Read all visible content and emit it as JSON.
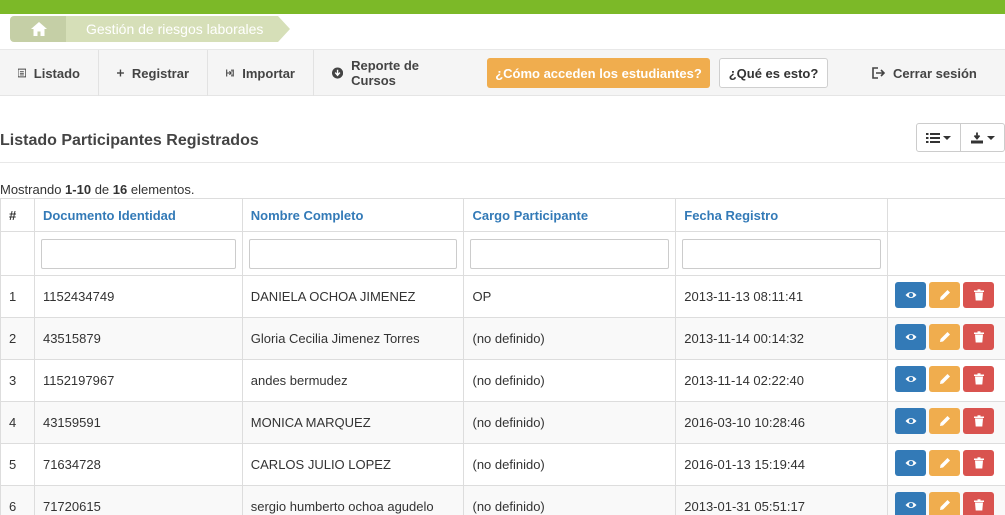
{
  "breadcrumb": {
    "home_icon": "home-icon",
    "current": "Gestión de riesgos laborales"
  },
  "toolbar": {
    "list_label": "Listado",
    "register_label": "Registrar",
    "import_label": "Importar",
    "report_label": "Reporte de Cursos",
    "how_label": "¿Cómo acceden los estudiantes?",
    "what_label": "¿Qué es esto?",
    "logout_label": "Cerrar sesión"
  },
  "page": {
    "title": "Listado Participantes Registrados",
    "summary_prefix": "Mostrando ",
    "summary_range": "1-10",
    "summary_mid": " de ",
    "summary_total": "16",
    "summary_suffix": " elementos."
  },
  "table": {
    "columns": [
      "#",
      "Documento Identidad",
      "Nombre Completo",
      "Cargo Participante",
      "Fecha Registro"
    ],
    "rows": [
      {
        "num": "1",
        "doc": "1152434749",
        "name": "DANIELA OCHOA JIMENEZ",
        "cargo": "OP",
        "fecha": "2013-11-13 08:11:41"
      },
      {
        "num": "2",
        "doc": "43515879",
        "name": "Gloria Cecilia Jimenez Torres",
        "cargo": "(no definido)",
        "fecha": "2013-11-14 00:14:32"
      },
      {
        "num": "3",
        "doc": "1152197967",
        "name": "andes bermudez",
        "cargo": "(no definido)",
        "fecha": "2013-11-14 02:22:40"
      },
      {
        "num": "4",
        "doc": "43159591",
        "name": "MONICA MARQUEZ",
        "cargo": "(no definido)",
        "fecha": "2016-03-10 10:28:46"
      },
      {
        "num": "5",
        "doc": "71634728",
        "name": "CARLOS JULIO LOPEZ",
        "cargo": "(no definido)",
        "fecha": "2016-01-13 15:19:44"
      },
      {
        "num": "6",
        "doc": "71720615",
        "name": "sergio humberto ochoa agudelo",
        "cargo": "(no definido)",
        "fecha": "2013-01-31 05:51:17"
      }
    ]
  },
  "colors": {
    "brand_green": "#7cb928",
    "warning": "#f0ad4e",
    "primary": "#337ab7",
    "danger": "#d9534f"
  }
}
